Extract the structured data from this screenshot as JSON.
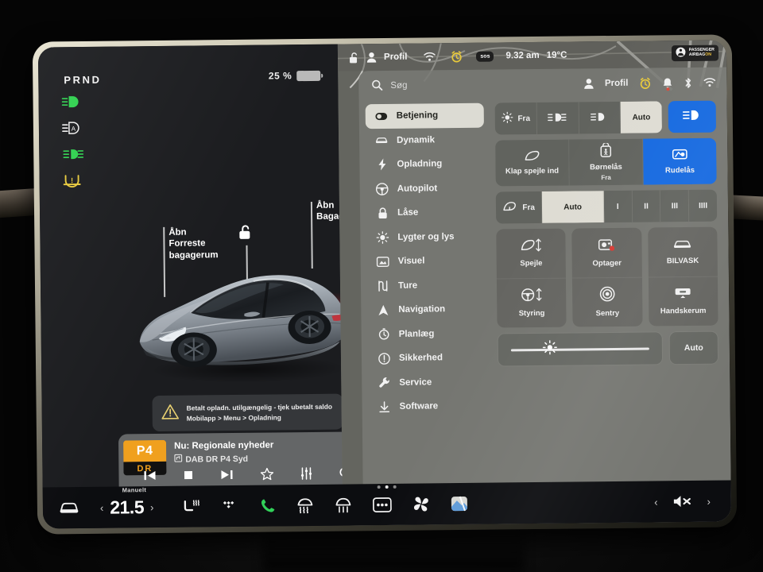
{
  "vehicle_pane": {
    "gear_indicator": "PRND",
    "battery": {
      "percent_label": "25 %",
      "level": 25
    },
    "indicator_lights": [
      {
        "name": "headlight-on-indicator",
        "color": "#2fd14f"
      },
      {
        "name": "auto-headlight-indicator",
        "color": "#f0f0f0"
      },
      {
        "name": "fog-light-indicator",
        "color": "#2fd14f"
      },
      {
        "name": "tire-pressure-warning-indicator",
        "color": "#e7c93c"
      }
    ],
    "callouts": {
      "frunk": "Åbn\nForreste\nbagagerum",
      "trunk": "Åbn\nBagagerum",
      "lock_icon": "unlock-icon"
    },
    "car_model": "Tesla Model 3",
    "car_color": "#9aa1a8",
    "notification": {
      "icon": "warning-triangle-icon",
      "line1": "Betalt opladn. utilgængelig - tjek ubetalt saldo",
      "line2": "Mobilapp > Menu > Opladning"
    },
    "media": {
      "logo_top": "P4",
      "logo_bottom": "DR",
      "now_playing": "Nu: Regionale nyheder",
      "station": "DAB DR P4 Syd",
      "controls": [
        "previous-icon",
        "stop-icon",
        "next-icon",
        "favorite-star-icon",
        "equalizer-icon",
        "search-icon"
      ]
    }
  },
  "status_bar": {
    "lock_icon": "unlock-icon",
    "profile_label": "Profil",
    "wifi_icon": "wifi-icon",
    "alarm_icon": "alarm-clock-icon",
    "sos_label": "sos",
    "time": "9.32 am",
    "temperature": "19°C",
    "airbag_badge": {
      "line1": "PASSENGER",
      "line2": "AIRBAG",
      "state": "ON"
    }
  },
  "settings": {
    "search": {
      "placeholder": "Søg",
      "value": ""
    },
    "top_right": {
      "profile_label": "Profil",
      "icons": [
        "alarm-clock-icon",
        "notification-bell-icon",
        "bluetooth-icon",
        "wifi-icon"
      ]
    },
    "sidebar": [
      {
        "label": "Betjening",
        "icon": "toggle-switch-icon",
        "active": true
      },
      {
        "label": "Dynamik",
        "icon": "car-icon",
        "active": false
      },
      {
        "label": "Opladning",
        "icon": "bolt-icon",
        "active": false
      },
      {
        "label": "Autopilot",
        "icon": "steering-wheel-icon",
        "active": false
      },
      {
        "label": "Låse",
        "icon": "lock-icon",
        "active": false
      },
      {
        "label": "Lygter og lys",
        "icon": "sun-icon",
        "active": false
      },
      {
        "label": "Visuel",
        "icon": "display-icon",
        "active": false
      },
      {
        "label": "Ture",
        "icon": "route-icon",
        "active": false
      },
      {
        "label": "Navigation",
        "icon": "navigation-arrow-icon",
        "active": false
      },
      {
        "label": "Planlæg",
        "icon": "clock-icon",
        "active": false
      },
      {
        "label": "Sikkerhed",
        "icon": "info-circle-icon",
        "active": false
      },
      {
        "label": "Service",
        "icon": "wrench-icon",
        "active": false
      },
      {
        "label": "Software",
        "icon": "download-icon",
        "active": false
      }
    ],
    "headlight_row": [
      {
        "label": "Fra",
        "icon": "lights-off-icon",
        "selected": false
      },
      {
        "label": "",
        "icon": "fog-light-icon",
        "selected": false
      },
      {
        "label": "",
        "icon": "low-beam-icon",
        "selected": false
      },
      {
        "label": "Auto",
        "icon": "",
        "selected": true
      }
    ],
    "highbeam_button": {
      "icon": "high-beam-icon",
      "active": true,
      "color": "#1569e0"
    },
    "quick_cards": [
      {
        "label": "Klap spejle ind",
        "sublabel": "",
        "icon": "mirror-icon",
        "active": false
      },
      {
        "label": "Børnelås",
        "sublabel": "Fra",
        "icon": "child-lock-icon",
        "active": false
      },
      {
        "label": "Rudelås",
        "sublabel": "",
        "icon": "window-lock-icon",
        "active": true
      }
    ],
    "wiper_row": [
      {
        "label": "Fra",
        "icon": "wiper-icon",
        "selected": false
      },
      {
        "label": "Auto",
        "icon": "",
        "selected": true
      },
      {
        "label": "I",
        "icon": "",
        "selected": false
      },
      {
        "label": "II",
        "icon": "",
        "selected": false
      },
      {
        "label": "III",
        "icon": "",
        "selected": false
      },
      {
        "label": "IIII",
        "icon": "",
        "selected": false
      }
    ],
    "tiles": [
      {
        "label": "Spejle",
        "icon": "mirror-adjust-icon"
      },
      {
        "label": "Styring",
        "icon": "steering-adjust-icon"
      },
      {
        "label": "Optager",
        "icon": "dashcam-icon"
      },
      {
        "label": "Sentry",
        "icon": "sentry-mode-icon"
      },
      {
        "label": "BILVASK",
        "icon": "car-wash-icon"
      },
      {
        "label": "Handskerum",
        "icon": "glovebox-icon"
      }
    ],
    "brightness": {
      "icon": "brightness-sun-icon",
      "value_percent": 28,
      "auto_label": "Auto"
    }
  },
  "taskbar": {
    "car_icon": "car-front-icon",
    "climate": {
      "mode_label": "Manuelt",
      "temperature": "21.5",
      "prev": "‹",
      "next": "›"
    },
    "icons": [
      "seat-heater-icon",
      "tidal-icon",
      "phone-icon",
      "rear-defrost-icon",
      "front-defrost-icon",
      "dots-menu-icon",
      "fan-icon",
      "maps-app-icon"
    ],
    "volume": {
      "prev": "‹",
      "mute_icon": "volume-mute-icon",
      "next": "›"
    },
    "page_dots": 3,
    "active_dot": 1
  }
}
